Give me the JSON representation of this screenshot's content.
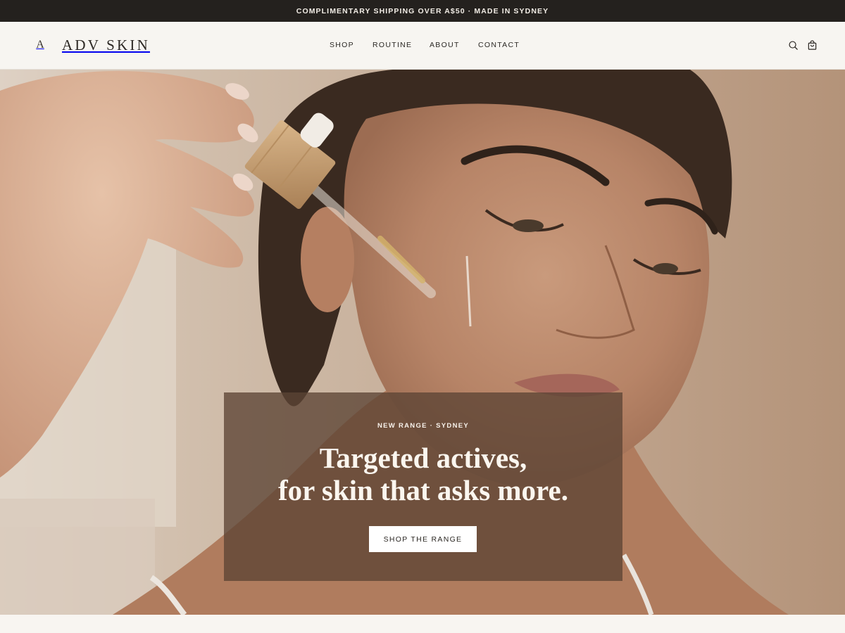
{
  "announcement": "COMPLIMENTARY SHIPPING OVER A$50 · MADE IN SYDNEY",
  "brand": {
    "mark": "A",
    "name": "ADV SKIN"
  },
  "nav": {
    "shop": "SHOP",
    "routine": "ROUTINE",
    "about": "ABOUT",
    "contact": "CONTACT"
  },
  "icons": {
    "search": "search-icon",
    "cart": "cart-icon"
  },
  "hero": {
    "eyebrow": "NEW RANGE · SYDNEY",
    "headline_line1": "Targeted actives,",
    "headline_line2": "for skin that asks more.",
    "cta_label": "SHOP THE RANGE",
    "image_alt": "Woman applying serum with a bamboo-capped dropper"
  },
  "colors": {
    "announce_bg": "#24211e",
    "header_bg": "#f7f5f1",
    "card_bg": "#5c4434",
    "cta_bg": "#ffffff"
  }
}
